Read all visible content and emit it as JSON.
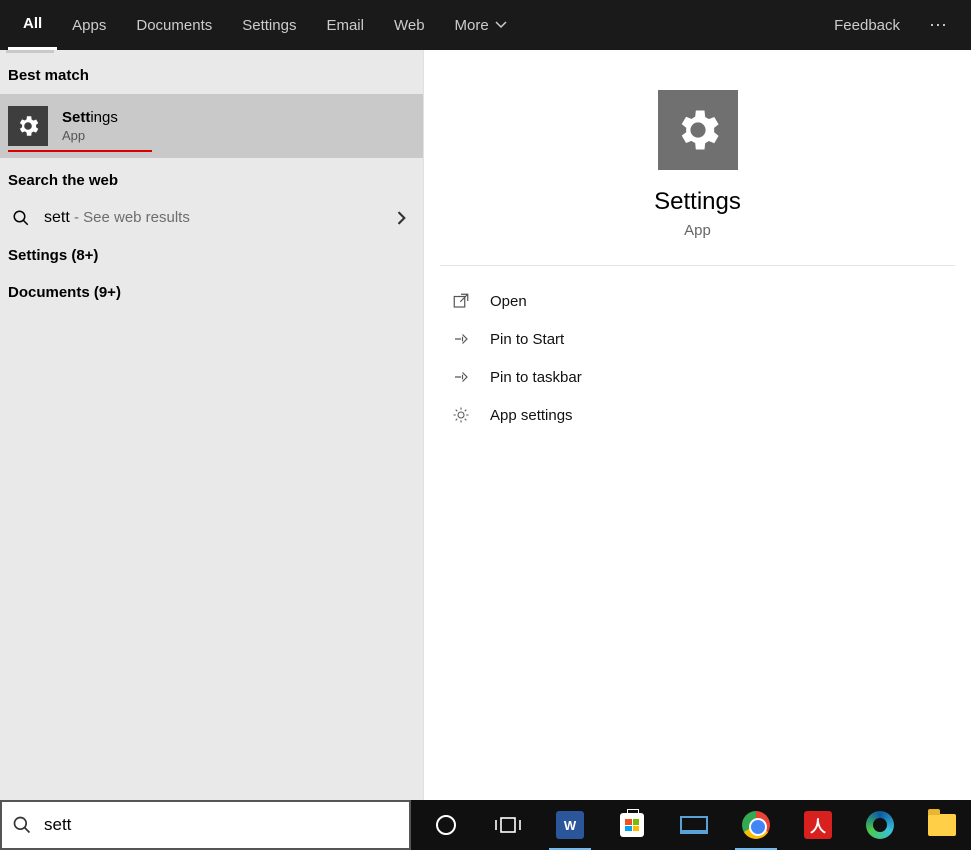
{
  "topbar": {
    "tabs": [
      "All",
      "Apps",
      "Documents",
      "Settings",
      "Email",
      "Web",
      "More"
    ],
    "active": "All",
    "feedback": "Feedback"
  },
  "left": {
    "best_match_header": "Best match",
    "best_item": {
      "title_bold": "Sett",
      "title_rest": "ings",
      "subtitle": "App"
    },
    "search_web_header": "Search the web",
    "web_item": {
      "query": "sett",
      "hint": " - See web results"
    },
    "categories": [
      "Settings (8+)",
      "Documents (9+)"
    ]
  },
  "preview": {
    "title": "Settings",
    "subtitle": "App",
    "actions": [
      "Open",
      "Pin to Start",
      "Pin to taskbar",
      "App settings"
    ]
  },
  "search": {
    "value": "sett"
  },
  "taskbar": {
    "items": [
      {
        "name": "cortana-icon"
      },
      {
        "name": "taskview-icon"
      },
      {
        "name": "word-icon",
        "underline": true
      },
      {
        "name": "store-icon"
      },
      {
        "name": "laptop-icon"
      },
      {
        "name": "chrome-icon",
        "underline": true
      },
      {
        "name": "pdf-icon"
      },
      {
        "name": "edge-icon"
      },
      {
        "name": "explorer-icon"
      }
    ]
  }
}
